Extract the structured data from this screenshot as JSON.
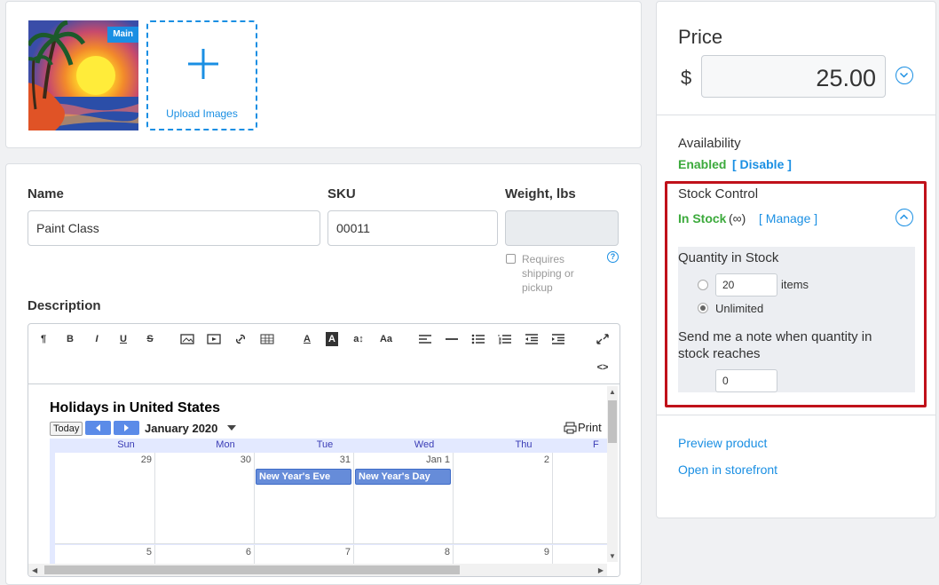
{
  "images": {
    "main_badge": "Main",
    "upload_label": "Upload Images"
  },
  "details": {
    "name_label": "Name",
    "name_value": "Paint Class",
    "sku_label": "SKU",
    "sku_value": "00011",
    "weight_label": "Weight, lbs",
    "weight_value": "",
    "requires_shipping": "Requires shipping or pickup",
    "help_symbol": "?",
    "description_label": "Description"
  },
  "editor": {
    "tools": [
      "¶",
      "B",
      "I",
      "U",
      "S",
      "img",
      "video",
      "link",
      "table",
      "A",
      "A",
      "a↕",
      "Aa",
      "align",
      "hr",
      "ul",
      "ol",
      "outdent",
      "indent",
      "fullscreen"
    ],
    "code_view": "<>"
  },
  "calendar": {
    "title": "Holidays in United States",
    "today_label": "Today",
    "month": "January 2020",
    "print_label": "Print",
    "days": [
      "Sun",
      "Mon",
      "Tue",
      "Wed",
      "Thu",
      "F"
    ],
    "week1": [
      "29",
      "30",
      "31",
      "Jan 1",
      "2",
      ""
    ],
    "week2": [
      "5",
      "6",
      "7",
      "8",
      "9",
      ""
    ],
    "events": [
      {
        "label": "New Year's Eve"
      },
      {
        "label": "New Year's Day"
      }
    ]
  },
  "side": {
    "price_label": "Price",
    "currency": "$",
    "price_value": "25.00",
    "availability_label": "Availability",
    "availability_status": "Enabled",
    "disable_link": "[ Disable ]",
    "stock_control_label": "Stock Control",
    "stock_status": "In Stock",
    "stock_infinity": "(∞)",
    "manage_link": "[ Manage ]",
    "quantity_label": "Quantity in Stock",
    "quantity_value": "20",
    "items_label": "items",
    "unlimited_label": "Unlimited",
    "note_label": "Send me a note when quantity in stock reaches",
    "note_value": "0",
    "preview_link": "Preview product",
    "storefront_link": "Open in storefront"
  },
  "colors": {
    "accent": "#1a8fe3",
    "success": "#3caa3c",
    "highlight": "#c0111a"
  }
}
